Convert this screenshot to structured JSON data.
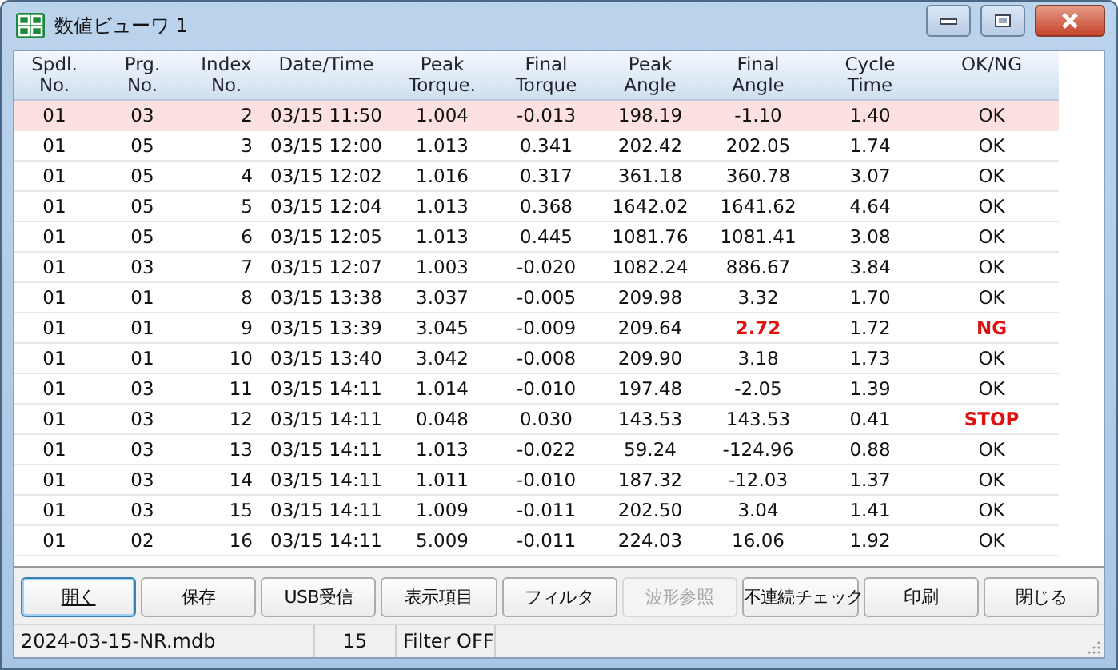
{
  "window": {
    "title": "数値ビューワ 1"
  },
  "table": {
    "columns": [
      "Spdl.\nNo.",
      "Prg.\nNo.",
      "Index\nNo.",
      "Date/Time",
      "Peak\nTorque.",
      "Final\nTorque",
      "Peak\nAngle",
      "Final\nAngle",
      "Cycle\nTime",
      "OK/NG"
    ],
    "rows": [
      {
        "selected": true,
        "final_angle_alert": false,
        "result_alert": false,
        "cells": [
          "01",
          "03",
          "2",
          "03/15 11:50",
          "1.004",
          "-0.013",
          "198.19",
          "-1.10",
          "1.40",
          "OK"
        ]
      },
      {
        "selected": false,
        "final_angle_alert": false,
        "result_alert": false,
        "cells": [
          "01",
          "05",
          "3",
          "03/15 12:00",
          "1.013",
          "0.341",
          "202.42",
          "202.05",
          "1.74",
          "OK"
        ]
      },
      {
        "selected": false,
        "final_angle_alert": false,
        "result_alert": false,
        "cells": [
          "01",
          "05",
          "4",
          "03/15 12:02",
          "1.016",
          "0.317",
          "361.18",
          "360.78",
          "3.07",
          "OK"
        ]
      },
      {
        "selected": false,
        "final_angle_alert": false,
        "result_alert": false,
        "cells": [
          "01",
          "05",
          "5",
          "03/15 12:04",
          "1.013",
          "0.368",
          "1642.02",
          "1641.62",
          "4.64",
          "OK"
        ]
      },
      {
        "selected": false,
        "final_angle_alert": false,
        "result_alert": false,
        "cells": [
          "01",
          "05",
          "6",
          "03/15 12:05",
          "1.013",
          "0.445",
          "1081.76",
          "1081.41",
          "3.08",
          "OK"
        ]
      },
      {
        "selected": false,
        "final_angle_alert": false,
        "result_alert": false,
        "cells": [
          "01",
          "03",
          "7",
          "03/15 12:07",
          "1.003",
          "-0.020",
          "1082.24",
          "886.67",
          "3.84",
          "OK"
        ]
      },
      {
        "selected": false,
        "final_angle_alert": false,
        "result_alert": false,
        "cells": [
          "01",
          "01",
          "8",
          "03/15 13:38",
          "3.037",
          "-0.005",
          "209.98",
          "3.32",
          "1.70",
          "OK"
        ]
      },
      {
        "selected": false,
        "final_angle_alert": true,
        "result_alert": true,
        "cells": [
          "01",
          "01",
          "9",
          "03/15 13:39",
          "3.045",
          "-0.009",
          "209.64",
          "2.72",
          "1.72",
          "NG"
        ]
      },
      {
        "selected": false,
        "final_angle_alert": false,
        "result_alert": false,
        "cells": [
          "01",
          "01",
          "10",
          "03/15 13:40",
          "3.042",
          "-0.008",
          "209.90",
          "3.18",
          "1.73",
          "OK"
        ]
      },
      {
        "selected": false,
        "final_angle_alert": false,
        "result_alert": false,
        "cells": [
          "01",
          "03",
          "11",
          "03/15 14:11",
          "1.014",
          "-0.010",
          "197.48",
          "-2.05",
          "1.39",
          "OK"
        ]
      },
      {
        "selected": false,
        "final_angle_alert": false,
        "result_alert": true,
        "cells": [
          "01",
          "03",
          "12",
          "03/15 14:11",
          "0.048",
          "0.030",
          "143.53",
          "143.53",
          "0.41",
          "STOP"
        ]
      },
      {
        "selected": false,
        "final_angle_alert": false,
        "result_alert": false,
        "cells": [
          "01",
          "03",
          "13",
          "03/15 14:11",
          "1.013",
          "-0.022",
          "59.24",
          "-124.96",
          "0.88",
          "OK"
        ]
      },
      {
        "selected": false,
        "final_angle_alert": false,
        "result_alert": false,
        "cells": [
          "01",
          "03",
          "14",
          "03/15 14:11",
          "1.011",
          "-0.010",
          "187.32",
          "-12.03",
          "1.37",
          "OK"
        ]
      },
      {
        "selected": false,
        "final_angle_alert": false,
        "result_alert": false,
        "cells": [
          "01",
          "03",
          "15",
          "03/15 14:11",
          "1.009",
          "-0.011",
          "202.50",
          "3.04",
          "1.41",
          "OK"
        ]
      },
      {
        "selected": false,
        "final_angle_alert": false,
        "result_alert": false,
        "cells": [
          "01",
          "02",
          "16",
          "03/15 14:11",
          "5.009",
          "-0.011",
          "224.03",
          "16.06",
          "1.92",
          "OK"
        ]
      }
    ]
  },
  "buttons": [
    {
      "label": "開く",
      "disabled": false,
      "focused": true
    },
    {
      "label": "保存",
      "disabled": false,
      "focused": false
    },
    {
      "label": "USB受信",
      "disabled": false,
      "focused": false
    },
    {
      "label": "表示項目",
      "disabled": false,
      "focused": false
    },
    {
      "label": "フィルタ",
      "disabled": false,
      "focused": false
    },
    {
      "label": "波形参照",
      "disabled": true,
      "focused": false
    },
    {
      "label": "不連続チェック",
      "disabled": false,
      "focused": false
    },
    {
      "label": "印刷",
      "disabled": false,
      "focused": false
    },
    {
      "label": "閉じる",
      "disabled": false,
      "focused": false
    }
  ],
  "status_bar": {
    "file": "2024-03-15-NR.mdb",
    "count": "15",
    "filter": "Filter OFF"
  }
}
